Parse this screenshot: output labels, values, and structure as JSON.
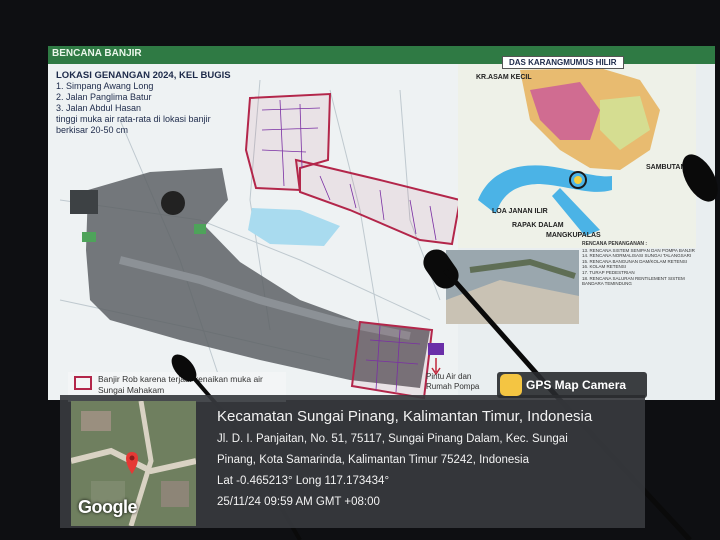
{
  "slide": {
    "title": "BENCANA BANJIR",
    "location_heading": "LOKASI GENANGAN 2024, KEL BUGIS",
    "locations": [
      "1.    Simpang Awang Long",
      "2.    Jalan Panglima Batur",
      "3.    Jalan Abdul Hasan"
    ],
    "water_note": "tinggi muka air rata-rata di lokasi banjir berkisar 20-50 cm",
    "inset_title": "DAS KARANGMUMUS HILIR",
    "inset_labels": [
      "KR.ASAM KECIL",
      "SAMBUTAN",
      "LOA JANAN ILIR",
      "RAPAK DALAM",
      "MANGKUPALAS"
    ],
    "legend_text": "Banjir Rob karena terjadi kenaikan muka air Sungai Mahakam",
    "pump_label": "Pintu Air dan Rumah Pompa",
    "plan_heading": "RENCANA PENANGANAN :",
    "plan_items": [
      "13. RENCANA SISTEM SENIPAN DAN POMPA BANJIR",
      "14. RENCANA NORMALISASI SUNGAI TALANGSARI",
      "15. RENCANA BANGUNAN DAM/KOLAM RETENSI",
      "16. KOLAM RETENSI",
      "17. TURAP PEDESTRIAN",
      "18. RENCANA SALURAN RENTILEMENT SISTEM BANDARA TEMINDUNG"
    ]
  },
  "overlay": {
    "app_name": "GPS Map Camera",
    "place": "Kecamatan Sungai Pinang, Kalimantan Timur, Indonesia",
    "address_1": "Jl. D. I. Panjaitan, No. 51, 75117, Sungai Pinang Dalam, Kec. Sungai",
    "address_2": "Pinang, Kota Samarinda, Kalimantan Timur 75242, Indonesia",
    "coords": "Lat -0.465213° Long 117.173434°",
    "datetime": "25/11/24 09:59 AM GMT +08:00",
    "map_brand": "Google"
  },
  "colors": {
    "slide_header": "#2f7a44",
    "flood_outline": "#b3264a",
    "river": "#4bb3e6"
  }
}
